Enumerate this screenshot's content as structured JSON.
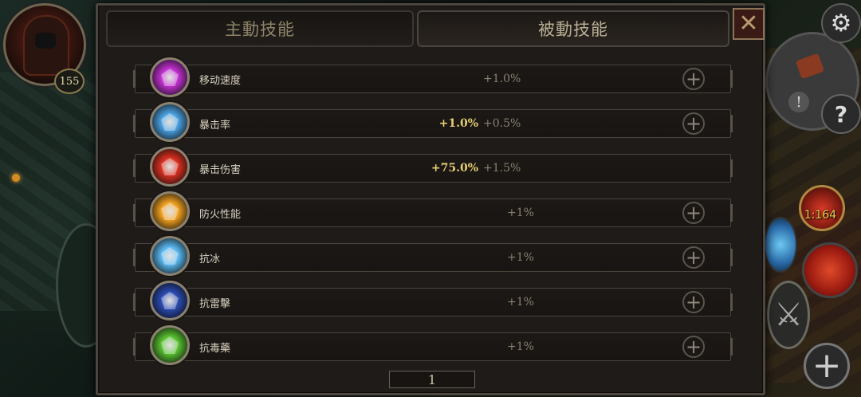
{
  "tabs": {
    "active_skills": "主動技能",
    "passive_skills": "被動技能"
  },
  "close_label": "✕",
  "player": {
    "level": "155"
  },
  "hud": {
    "potion_count": "1:164"
  },
  "skills": [
    {
      "name": "移动速度",
      "current": "",
      "step": "+1.0%",
      "icon": "boot-speed-icon",
      "color": "#c030d0"
    },
    {
      "name": "暴击率",
      "current": "+1.0%",
      "step": "+0.5%",
      "icon": "crit-blade-icon",
      "color": "#4aa0e0"
    },
    {
      "name": "暴击伤害",
      "current": "+75.0%",
      "step": "+1.5%",
      "icon": "crit-damage-icon",
      "color": "#d83020"
    },
    {
      "name": "防火性能",
      "current": "",
      "step": "+1%",
      "icon": "fire-shield-icon",
      "color": "#f0a020"
    },
    {
      "name": "抗冰",
      "current": "",
      "step": "+1%",
      "icon": "ice-shield-icon",
      "color": "#5ab8f0"
    },
    {
      "name": "抗雷擊",
      "current": "",
      "step": "+1%",
      "icon": "lightning-shield-icon",
      "color": "#2a4ab0"
    },
    {
      "name": "抗毒藥",
      "current": "",
      "step": "+1%",
      "icon": "poison-shield-icon",
      "color": "#58c030"
    }
  ],
  "pagination": {
    "page": "1"
  }
}
